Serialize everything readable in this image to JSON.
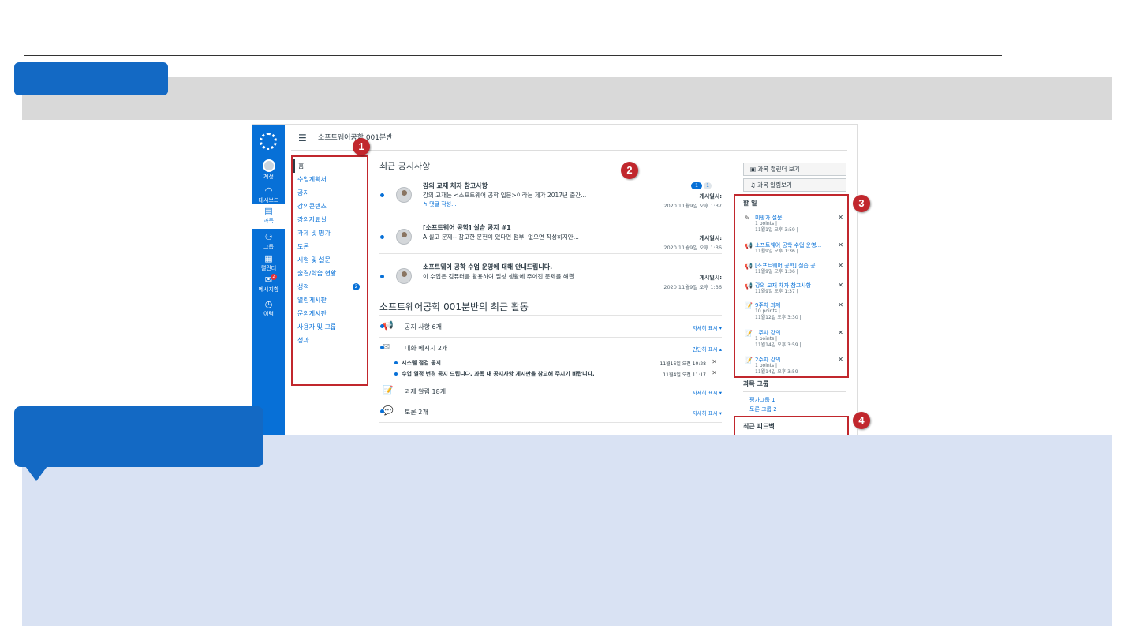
{
  "header": {
    "breadcrumb": "소프트웨어공학 001분반"
  },
  "global_nav": [
    {
      "label": "계정",
      "icon": "account-avatar-icon"
    },
    {
      "label": "대시보드",
      "icon": "dashboard-icon"
    },
    {
      "label": "과목",
      "icon": "courses-icon"
    },
    {
      "label": "그룹",
      "icon": "groups-icon"
    },
    {
      "label": "캘린더",
      "icon": "calendar-icon"
    },
    {
      "label": "메시지함",
      "icon": "inbox-icon",
      "badge": "2"
    },
    {
      "label": "이력",
      "icon": "history-clock-icon"
    }
  ],
  "course_nav": [
    "홈",
    "수업계획서",
    "공지",
    "강의콘텐츠",
    "강의자료실",
    "과제 및 평가",
    "토론",
    "시험 및 설문",
    "출결/학습 현황",
    "성적",
    "열린게시판",
    "문의게시판",
    "사용자 및 그룹",
    "성과"
  ],
  "course_nav_badge": "2",
  "announcements": {
    "heading": "최근 공지사항",
    "items": [
      {
        "title": "강의 교재 채자 참고사항",
        "message": "강의 교재는 <소프트웨어 공학 입문>이라는 제가 2017년 출간...",
        "reply": "댓글 작성...",
        "posted": "게시일시:",
        "date": "2020 11월9일 오후 1:37",
        "unread": "1",
        "total": "1"
      },
      {
        "title": "[소프트웨어 공학] 실습 공지 #1",
        "message": "A 실고 문제-- 참고한 문헌이 있다면 첨부, 없으면 작성하지만...",
        "posted": "게시일시:",
        "date": "2020 11월9일 오후 1:36"
      },
      {
        "title": "소프트웨어 공학 수업 운영에 대해 안내드립니다.",
        "message": "이 수업은 컴퓨터를 활용하여 일상 생활에 주어진 문제를 해결...",
        "posted": "게시일시:",
        "date": "2020 11월9일 오후 1:36"
      }
    ]
  },
  "activity": {
    "heading": "소프트웨어공학 001분반의 최근 활동",
    "items": [
      {
        "label": "공지 사항 6개",
        "detail": "자세히 표시"
      },
      {
        "label": "대화 메시지 2개",
        "detail": "간단히 표시"
      },
      {
        "label": "과제 알림 18개",
        "detail": "자세히 표시"
      },
      {
        "label": "토론 2개",
        "detail": "자세히 표시"
      }
    ],
    "messages": [
      {
        "text": "시스템 점검 공지",
        "time": "11월16일 오전 10:28"
      },
      {
        "text": "수업 일정 변경 공지 드립니다. 과목 내 공지사항 게시판을 참고해 주시기 바랍니다.",
        "time": "11월4일 오전 11:17"
      }
    ]
  },
  "right": {
    "calendar_btn": "과목 캘린더 보기",
    "notify_btn": "과목 알림보기",
    "todo_heading": "할 일",
    "todos": [
      {
        "icon": "quiz-icon",
        "title": "미평가 설문",
        "line1": "1 points  |",
        "line2": "11월1일 오후 3:59  |"
      },
      {
        "icon": "announcement-icon",
        "title": "소프트웨어 공학 수업 운영...",
        "line1": "11월9일 오후 1:36  |",
        "line2": ""
      },
      {
        "icon": "announcement-icon",
        "title": "[소프트웨어 공학] 실습 공...",
        "line1": "11월9일 오후 1:36  |",
        "line2": ""
      },
      {
        "icon": "announcement-icon",
        "title": "강의 교재 채자 참고사항",
        "line1": "11월9일 오후 1:37  |",
        "line2": ""
      },
      {
        "icon": "assignment-icon",
        "title": "9주차 과제",
        "line1": "10 points  |",
        "line2": "11월12일 오후 3:30  |"
      },
      {
        "icon": "assignment-icon",
        "title": "1주차 강의",
        "line1": "1 points  |",
        "line2": "11월14일 오후 3:59  |"
      },
      {
        "icon": "assignment-icon",
        "title": "2주차 강의",
        "line1": "1 points  |",
        "line2": "11월14일 오후 3:59"
      }
    ],
    "groups_heading": "과목 그룹",
    "groups": [
      "평가그룹 1",
      "토론 그룹 2"
    ],
    "feedback_heading": "최근 피드백"
  },
  "callouts": [
    "1",
    "2",
    "3",
    "4"
  ],
  "colors": {
    "brand": "#0770d7",
    "callout": "#c1272d",
    "slide_accent": "#1369c4",
    "panel": "#d9e2f3"
  }
}
